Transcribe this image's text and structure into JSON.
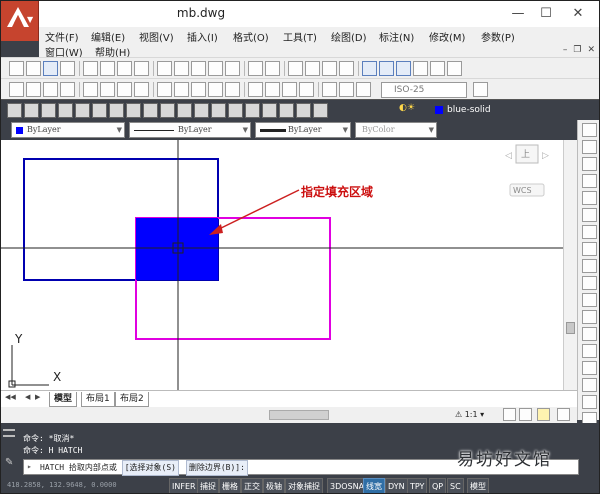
{
  "window": {
    "title": "mb.dwg",
    "controls": [
      "—",
      "☐",
      "✕"
    ]
  },
  "menu": {
    "row1": [
      "文件(F)",
      "编辑(E)",
      "视图(V)",
      "插入(I)",
      "格式(O)",
      "工具(T)",
      "绘图(D)",
      "标注(N)",
      "修改(M)",
      "参数(P)"
    ],
    "row2": [
      "窗口(W)",
      "帮助(H)"
    ]
  },
  "toolbar": {
    "dimstyle": "ISO-25",
    "layer": "blue-solid"
  },
  "properties": {
    "color": "ByLayer",
    "linetype": "ByLayer",
    "lineweight": "ByLayer",
    "plotstyle": "ByColor"
  },
  "viewcube": {
    "face": "上",
    "ucs": "WCS"
  },
  "annotation": {
    "text": "指定填充区域"
  },
  "ucs": {
    "x": "X",
    "y": "Y"
  },
  "tabs": [
    "模型",
    "布局1",
    "布局2"
  ],
  "scale": "1:1",
  "command": {
    "history": [
      "命令: *取消*",
      "命令: H HATCH"
    ],
    "prompt": "HATCH 拾取内部点或",
    "options": [
      "[选择对象(S)",
      "删除边界(B)]:"
    ]
  },
  "status": {
    "coords": "418.2858, 132.9648, 0.0000",
    "toggles": [
      "INFER",
      "捕捉",
      "栅格",
      "正交",
      "极轴",
      "对象捕捉",
      "3DOSNAP",
      "线宽",
      "DYN",
      "TPY",
      "QP",
      "SC"
    ],
    "active_toggle": "线宽",
    "model_label": "模型"
  },
  "watermark": "易坊好文馆",
  "colors": {
    "hatch": "#0000ff",
    "blue_rect": "#0000b0",
    "magenta_rect": "#e000e0",
    "arrow": "#cc2020",
    "annotation": "#cc1010"
  }
}
